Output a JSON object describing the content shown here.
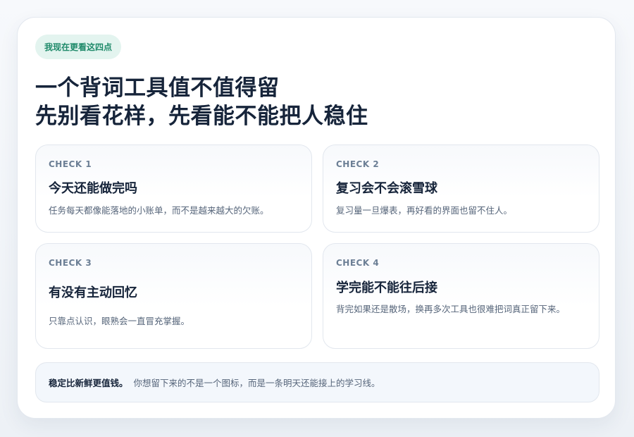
{
  "badge": "我现在更看这四点",
  "title": {
    "line1": "一个背词工具值不值得留",
    "line2": "先别看花样，先看能不能把人稳住"
  },
  "checks": [
    {
      "label": "CHECK 1",
      "title": "今天还能做完吗",
      "desc": "任务每天都像能落地的小账单，而不是越来越大的欠账。"
    },
    {
      "label": "CHECK 2",
      "title": "复习会不会滚雪球",
      "desc": "复习量一旦爆表，再好看的界面也留不住人。"
    },
    {
      "label": "CHECK 3",
      "title": "有没有主动回忆",
      "desc": "只靠点认识，眼熟会一直冒充掌握。"
    },
    {
      "label": "CHECK 4",
      "title": "学完能不能往后接",
      "desc": "背完如果还是散场，换再多次工具也很难把词真正留下来。"
    }
  ],
  "footer": {
    "strong": "稳定比新鲜更值钱。",
    "text": "你想留下来的不是一个图标，而是一条明天还能接上的学习线。"
  }
}
